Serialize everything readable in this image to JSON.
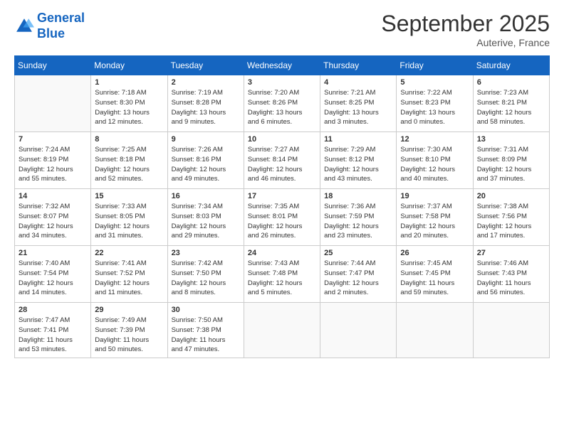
{
  "logo": {
    "line1": "General",
    "line2": "Blue"
  },
  "title": "September 2025",
  "subtitle": "Auterive, France",
  "weekdays": [
    "Sunday",
    "Monday",
    "Tuesday",
    "Wednesday",
    "Thursday",
    "Friday",
    "Saturday"
  ],
  "weeks": [
    [
      {
        "day": "",
        "info": ""
      },
      {
        "day": "1",
        "info": "Sunrise: 7:18 AM\nSunset: 8:30 PM\nDaylight: 13 hours\nand 12 minutes."
      },
      {
        "day": "2",
        "info": "Sunrise: 7:19 AM\nSunset: 8:28 PM\nDaylight: 13 hours\nand 9 minutes."
      },
      {
        "day": "3",
        "info": "Sunrise: 7:20 AM\nSunset: 8:26 PM\nDaylight: 13 hours\nand 6 minutes."
      },
      {
        "day": "4",
        "info": "Sunrise: 7:21 AM\nSunset: 8:25 PM\nDaylight: 13 hours\nand 3 minutes."
      },
      {
        "day": "5",
        "info": "Sunrise: 7:22 AM\nSunset: 8:23 PM\nDaylight: 13 hours\nand 0 minutes."
      },
      {
        "day": "6",
        "info": "Sunrise: 7:23 AM\nSunset: 8:21 PM\nDaylight: 12 hours\nand 58 minutes."
      }
    ],
    [
      {
        "day": "7",
        "info": "Sunrise: 7:24 AM\nSunset: 8:19 PM\nDaylight: 12 hours\nand 55 minutes."
      },
      {
        "day": "8",
        "info": "Sunrise: 7:25 AM\nSunset: 8:18 PM\nDaylight: 12 hours\nand 52 minutes."
      },
      {
        "day": "9",
        "info": "Sunrise: 7:26 AM\nSunset: 8:16 PM\nDaylight: 12 hours\nand 49 minutes."
      },
      {
        "day": "10",
        "info": "Sunrise: 7:27 AM\nSunset: 8:14 PM\nDaylight: 12 hours\nand 46 minutes."
      },
      {
        "day": "11",
        "info": "Sunrise: 7:29 AM\nSunset: 8:12 PM\nDaylight: 12 hours\nand 43 minutes."
      },
      {
        "day": "12",
        "info": "Sunrise: 7:30 AM\nSunset: 8:10 PM\nDaylight: 12 hours\nand 40 minutes."
      },
      {
        "day": "13",
        "info": "Sunrise: 7:31 AM\nSunset: 8:09 PM\nDaylight: 12 hours\nand 37 minutes."
      }
    ],
    [
      {
        "day": "14",
        "info": "Sunrise: 7:32 AM\nSunset: 8:07 PM\nDaylight: 12 hours\nand 34 minutes."
      },
      {
        "day": "15",
        "info": "Sunrise: 7:33 AM\nSunset: 8:05 PM\nDaylight: 12 hours\nand 31 minutes."
      },
      {
        "day": "16",
        "info": "Sunrise: 7:34 AM\nSunset: 8:03 PM\nDaylight: 12 hours\nand 29 minutes."
      },
      {
        "day": "17",
        "info": "Sunrise: 7:35 AM\nSunset: 8:01 PM\nDaylight: 12 hours\nand 26 minutes."
      },
      {
        "day": "18",
        "info": "Sunrise: 7:36 AM\nSunset: 7:59 PM\nDaylight: 12 hours\nand 23 minutes."
      },
      {
        "day": "19",
        "info": "Sunrise: 7:37 AM\nSunset: 7:58 PM\nDaylight: 12 hours\nand 20 minutes."
      },
      {
        "day": "20",
        "info": "Sunrise: 7:38 AM\nSunset: 7:56 PM\nDaylight: 12 hours\nand 17 minutes."
      }
    ],
    [
      {
        "day": "21",
        "info": "Sunrise: 7:40 AM\nSunset: 7:54 PM\nDaylight: 12 hours\nand 14 minutes."
      },
      {
        "day": "22",
        "info": "Sunrise: 7:41 AM\nSunset: 7:52 PM\nDaylight: 12 hours\nand 11 minutes."
      },
      {
        "day": "23",
        "info": "Sunrise: 7:42 AM\nSunset: 7:50 PM\nDaylight: 12 hours\nand 8 minutes."
      },
      {
        "day": "24",
        "info": "Sunrise: 7:43 AM\nSunset: 7:48 PM\nDaylight: 12 hours\nand 5 minutes."
      },
      {
        "day": "25",
        "info": "Sunrise: 7:44 AM\nSunset: 7:47 PM\nDaylight: 12 hours\nand 2 minutes."
      },
      {
        "day": "26",
        "info": "Sunrise: 7:45 AM\nSunset: 7:45 PM\nDaylight: 11 hours\nand 59 minutes."
      },
      {
        "day": "27",
        "info": "Sunrise: 7:46 AM\nSunset: 7:43 PM\nDaylight: 11 hours\nand 56 minutes."
      }
    ],
    [
      {
        "day": "28",
        "info": "Sunrise: 7:47 AM\nSunset: 7:41 PM\nDaylight: 11 hours\nand 53 minutes."
      },
      {
        "day": "29",
        "info": "Sunrise: 7:49 AM\nSunset: 7:39 PM\nDaylight: 11 hours\nand 50 minutes."
      },
      {
        "day": "30",
        "info": "Sunrise: 7:50 AM\nSunset: 7:38 PM\nDaylight: 11 hours\nand 47 minutes."
      },
      {
        "day": "",
        "info": ""
      },
      {
        "day": "",
        "info": ""
      },
      {
        "day": "",
        "info": ""
      },
      {
        "day": "",
        "info": ""
      }
    ]
  ]
}
